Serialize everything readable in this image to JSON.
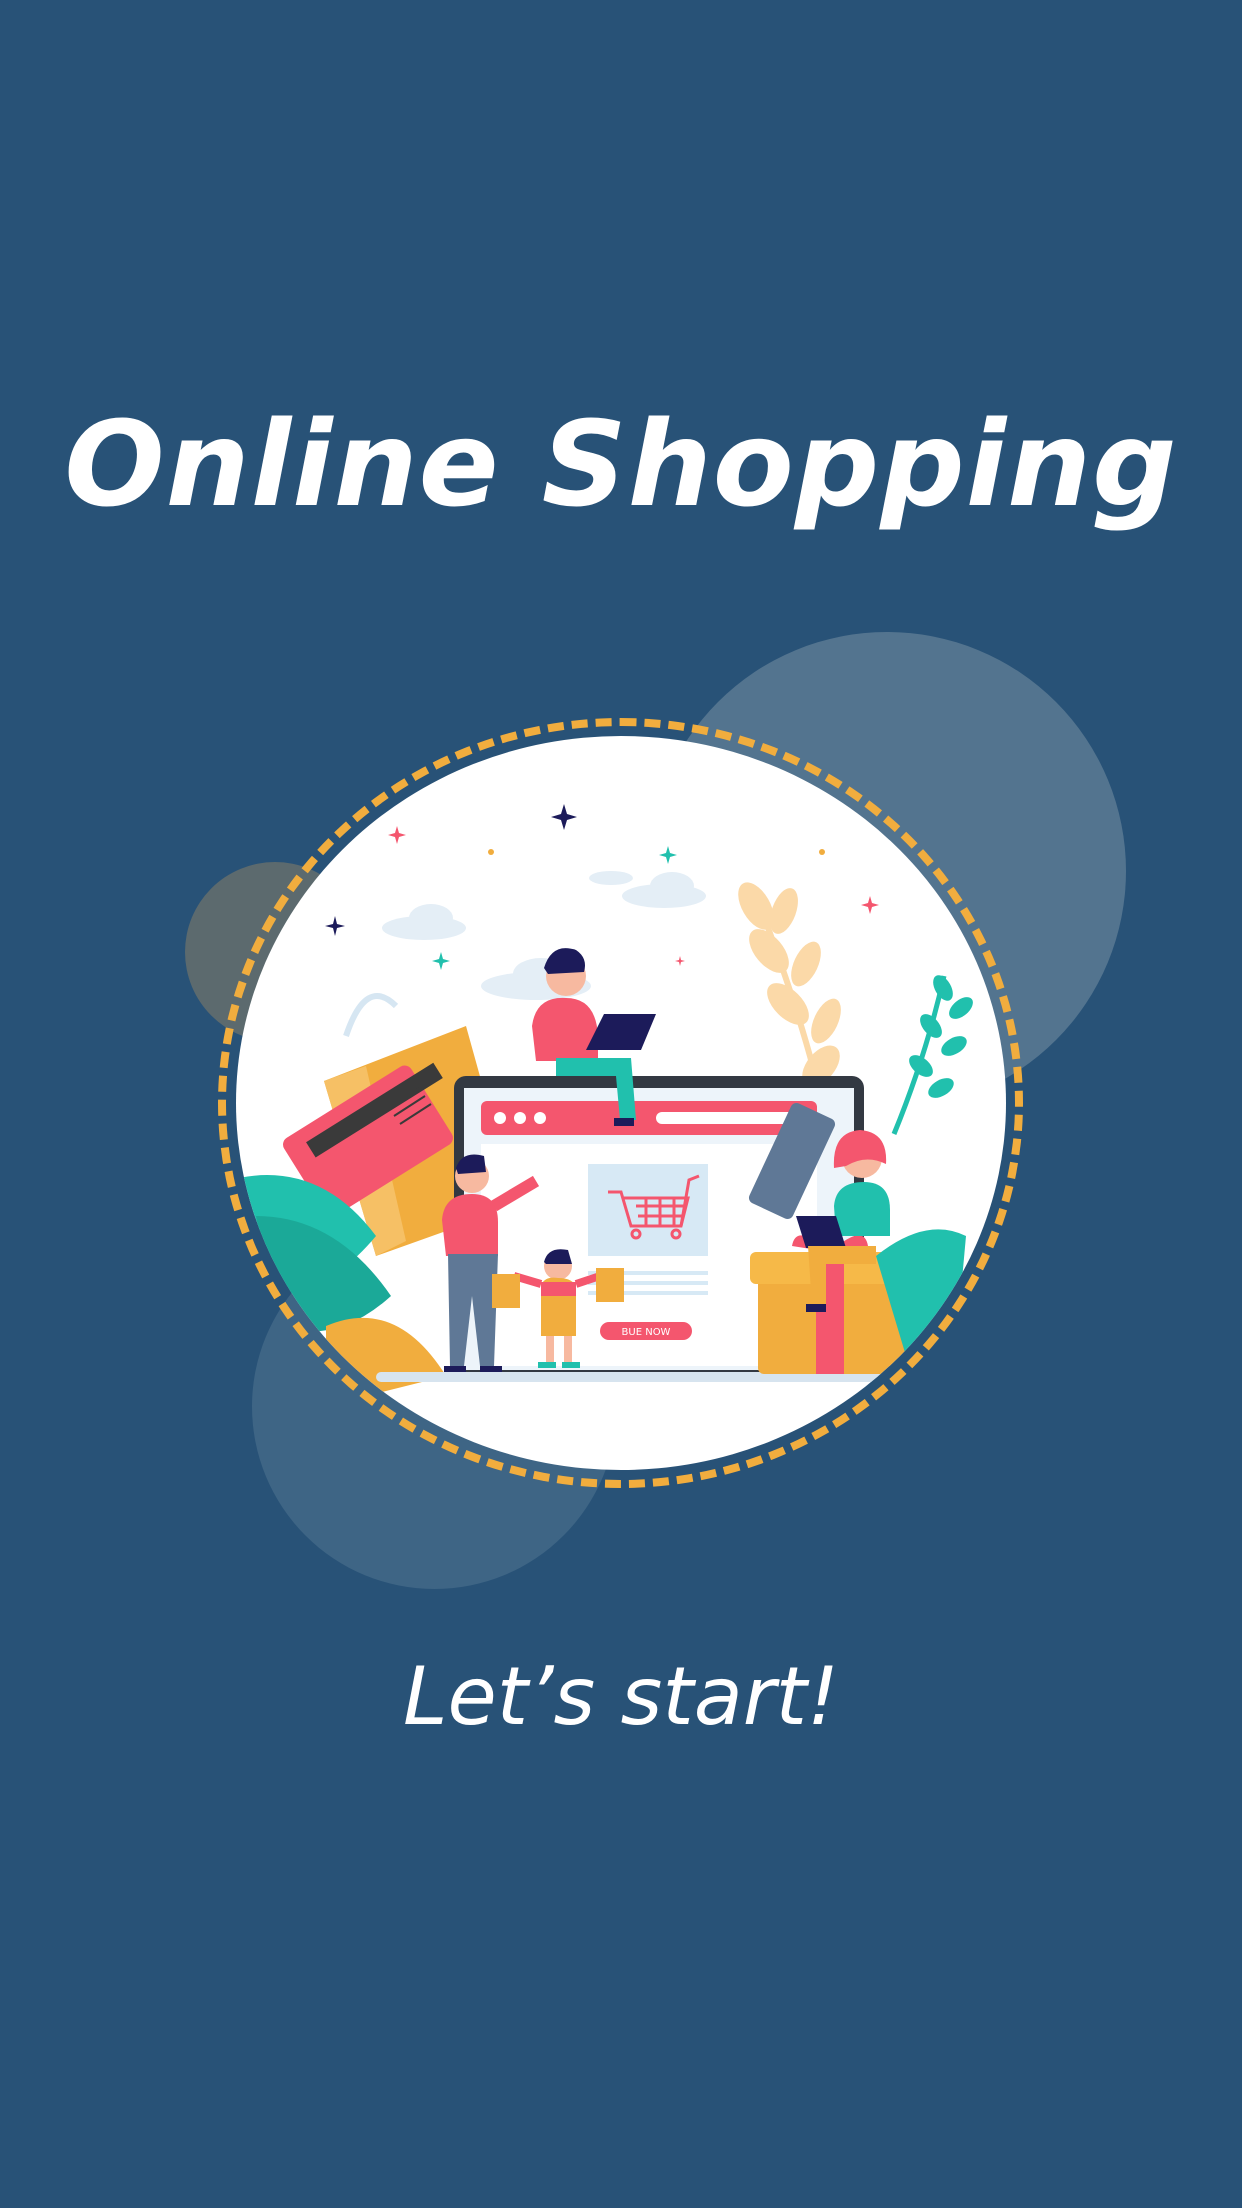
{
  "screen": {
    "title": "Online Shopping",
    "cta_label": "Let’s start!",
    "background_color": "#285277"
  },
  "illustration": {
    "button_label": "BUE NOW",
    "icons": [
      "shopping-cart-icon",
      "shopping-bag-icon",
      "credit-card-icon",
      "gift-box-icon",
      "laptop-icon",
      "sparkle-icon"
    ],
    "accent_colors": {
      "pink": "#f4566e",
      "orange": "#f1ad3e",
      "teal": "#21c0ad",
      "navy": "#1c1b5a"
    }
  }
}
